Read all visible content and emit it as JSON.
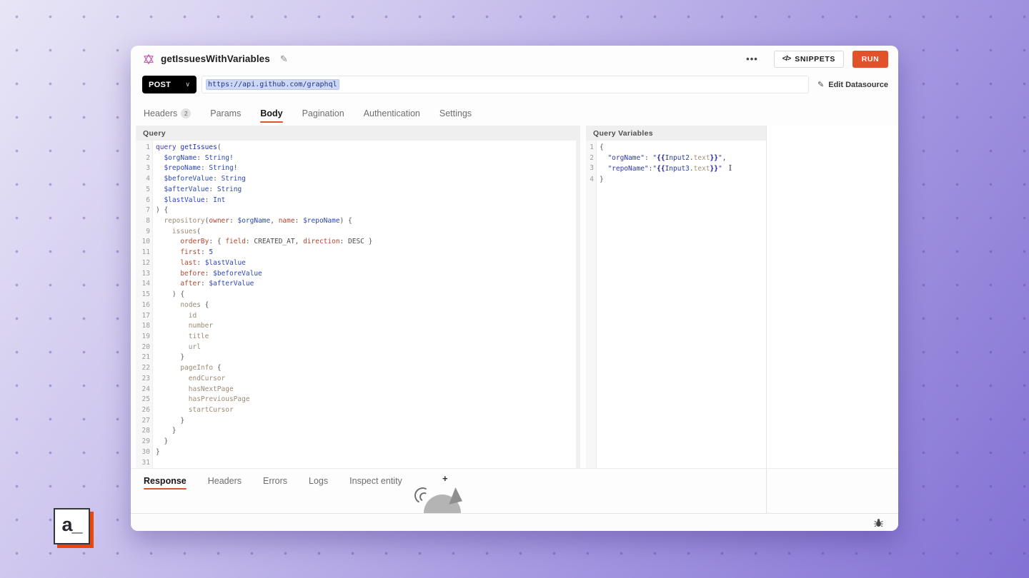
{
  "window": {
    "title": "getIssuesWithVariables",
    "more_label": "•••",
    "snippets_icon": "</>",
    "snippets_label": "SNIPPETS",
    "run_label": "RUN"
  },
  "request": {
    "method": "POST",
    "caret": "∨",
    "url": "https://api.github.com/graphql",
    "edit_datasource": "Edit Datasource",
    "edit_icon": "✎",
    "rename_icon": "✎"
  },
  "request_tabs": [
    {
      "label": "Headers",
      "badge": "2",
      "active": false
    },
    {
      "label": "Params",
      "active": false
    },
    {
      "label": "Body",
      "active": true
    },
    {
      "label": "Pagination",
      "active": false
    },
    {
      "label": "Authentication",
      "active": false
    },
    {
      "label": "Settings",
      "active": false
    }
  ],
  "query_panel": {
    "title": "Query",
    "lines": [
      [
        [
          "kw",
          "query"
        ],
        [
          "t",
          " "
        ],
        [
          "def",
          "getIssues"
        ],
        [
          "p",
          "("
        ]
      ],
      [
        [
          "t",
          "  "
        ],
        [
          "var",
          "$orgName"
        ],
        [
          "p",
          ":"
        ],
        [
          "t",
          " "
        ],
        [
          "typ",
          "String!"
        ]
      ],
      [
        [
          "t",
          "  "
        ],
        [
          "var",
          "$repoName"
        ],
        [
          "p",
          ":"
        ],
        [
          "t",
          " "
        ],
        [
          "typ",
          "String!"
        ]
      ],
      [
        [
          "t",
          "  "
        ],
        [
          "var",
          "$beforeValue"
        ],
        [
          "p",
          ":"
        ],
        [
          "t",
          " "
        ],
        [
          "typ",
          "String"
        ]
      ],
      [
        [
          "t",
          "  "
        ],
        [
          "var",
          "$afterValue"
        ],
        [
          "p",
          ":"
        ],
        [
          "t",
          " "
        ],
        [
          "typ",
          "String"
        ]
      ],
      [
        [
          "t",
          "  "
        ],
        [
          "var",
          "$lastValue"
        ],
        [
          "p",
          ":"
        ],
        [
          "t",
          " "
        ],
        [
          "typ",
          "Int"
        ]
      ],
      [
        [
          "p",
          ") {"
        ]
      ],
      [
        [
          "t",
          "  "
        ],
        [
          "prop",
          "repository"
        ],
        [
          "p",
          "("
        ],
        [
          "attr",
          "owner"
        ],
        [
          "p",
          ":"
        ],
        [
          "t",
          " "
        ],
        [
          "var",
          "$orgName"
        ],
        [
          "p",
          ","
        ],
        [
          "t",
          " "
        ],
        [
          "attr",
          "name"
        ],
        [
          "p",
          ":"
        ],
        [
          "t",
          " "
        ],
        [
          "var",
          "$repoName"
        ],
        [
          "p",
          ")"
        ],
        [
          "t",
          " "
        ],
        [
          "p",
          "{"
        ]
      ],
      [
        [
          "t",
          "    "
        ],
        [
          "prop",
          "issues"
        ],
        [
          "p",
          "("
        ]
      ],
      [
        [
          "t",
          "      "
        ],
        [
          "attr",
          "orderBy"
        ],
        [
          "p",
          ":"
        ],
        [
          "t",
          " "
        ],
        [
          "p",
          "{"
        ],
        [
          "t",
          " "
        ],
        [
          "attr",
          "field"
        ],
        [
          "p",
          ":"
        ],
        [
          "t",
          " "
        ],
        [
          "atom",
          "CREATED_AT"
        ],
        [
          "p",
          ","
        ],
        [
          "t",
          " "
        ],
        [
          "attr",
          "direction"
        ],
        [
          "p",
          ":"
        ],
        [
          "t",
          " "
        ],
        [
          "atom",
          "DESC"
        ],
        [
          "t",
          " "
        ],
        [
          "p",
          "}"
        ]
      ],
      [
        [
          "t",
          "      "
        ],
        [
          "attr",
          "first"
        ],
        [
          "p",
          ":"
        ],
        [
          "t",
          " "
        ],
        [
          "num",
          "5"
        ]
      ],
      [
        [
          "t",
          "      "
        ],
        [
          "attr",
          "last"
        ],
        [
          "p",
          ":"
        ],
        [
          "t",
          " "
        ],
        [
          "var",
          "$lastValue"
        ]
      ],
      [
        [
          "t",
          "      "
        ],
        [
          "attr",
          "before"
        ],
        [
          "p",
          ":"
        ],
        [
          "t",
          " "
        ],
        [
          "var",
          "$beforeValue"
        ]
      ],
      [
        [
          "t",
          "      "
        ],
        [
          "attr",
          "after"
        ],
        [
          "p",
          ":"
        ],
        [
          "t",
          " "
        ],
        [
          "var",
          "$afterValue"
        ]
      ],
      [
        [
          "t",
          "    "
        ],
        [
          "p",
          ") {"
        ]
      ],
      [
        [
          "t",
          "      "
        ],
        [
          "prop",
          "nodes"
        ],
        [
          "t",
          " "
        ],
        [
          "p",
          "{"
        ]
      ],
      [
        [
          "t",
          "        "
        ],
        [
          "prop",
          "id"
        ]
      ],
      [
        [
          "t",
          "        "
        ],
        [
          "prop",
          "number"
        ]
      ],
      [
        [
          "t",
          "        "
        ],
        [
          "prop",
          "title"
        ]
      ],
      [
        [
          "t",
          "        "
        ],
        [
          "prop",
          "url"
        ]
      ],
      [
        [
          "t",
          "      "
        ],
        [
          "p",
          "}"
        ]
      ],
      [
        [
          "t",
          "      "
        ],
        [
          "prop",
          "pageInfo"
        ],
        [
          "t",
          " "
        ],
        [
          "p",
          "{"
        ]
      ],
      [
        [
          "t",
          "        "
        ],
        [
          "prop",
          "endCursor"
        ]
      ],
      [
        [
          "t",
          "        "
        ],
        [
          "prop",
          "hasNextPage"
        ]
      ],
      [
        [
          "t",
          "        "
        ],
        [
          "prop",
          "hasPreviousPage"
        ]
      ],
      [
        [
          "t",
          "        "
        ],
        [
          "prop",
          "startCursor"
        ]
      ],
      [
        [
          "t",
          "      "
        ],
        [
          "p",
          "}"
        ]
      ],
      [
        [
          "t",
          "    "
        ],
        [
          "p",
          "}"
        ]
      ],
      [
        [
          "t",
          "  "
        ],
        [
          "p",
          "}"
        ]
      ],
      [
        [
          "p",
          "}"
        ]
      ],
      []
    ]
  },
  "variables_panel": {
    "title": "Query Variables",
    "lines": [
      [
        [
          "p",
          "{"
        ]
      ],
      [
        [
          "t",
          "  "
        ],
        [
          "str",
          "\"orgName\""
        ],
        [
          "p",
          ":"
        ],
        [
          "t",
          " "
        ],
        [
          "str",
          "\""
        ],
        [
          "mus",
          "{{"
        ],
        [
          "name",
          "Input2"
        ],
        [
          "p",
          "."
        ],
        [
          "sub",
          "text"
        ],
        [
          "mus",
          "}}"
        ],
        [
          "str",
          "\","
        ]
      ],
      [
        [
          "t",
          "  "
        ],
        [
          "str",
          "\"repoName\""
        ],
        [
          "p",
          ":"
        ],
        [
          "str",
          "\""
        ],
        [
          "mus",
          "{{"
        ],
        [
          "name",
          "Input3"
        ],
        [
          "p",
          "."
        ],
        [
          "sub",
          "text"
        ],
        [
          "mus",
          "}}"
        ],
        [
          "str",
          "\""
        ],
        [
          "cur",
          "I"
        ]
      ],
      [
        [
          "p",
          "}"
        ]
      ]
    ]
  },
  "response_tabs": [
    {
      "label": "Response",
      "active": true
    },
    {
      "label": "Headers",
      "active": false
    },
    {
      "label": "Errors",
      "active": false
    },
    {
      "label": "Logs",
      "active": false
    },
    {
      "label": "Inspect entity",
      "active": false
    }
  ],
  "logo": {
    "text": "a_"
  },
  "colors": {
    "accent": "#e2512a",
    "method_bg": "#000000",
    "selection": "#ccd8f5",
    "background_top": "#e8e5f6",
    "background_bottom": "#8372d4"
  }
}
